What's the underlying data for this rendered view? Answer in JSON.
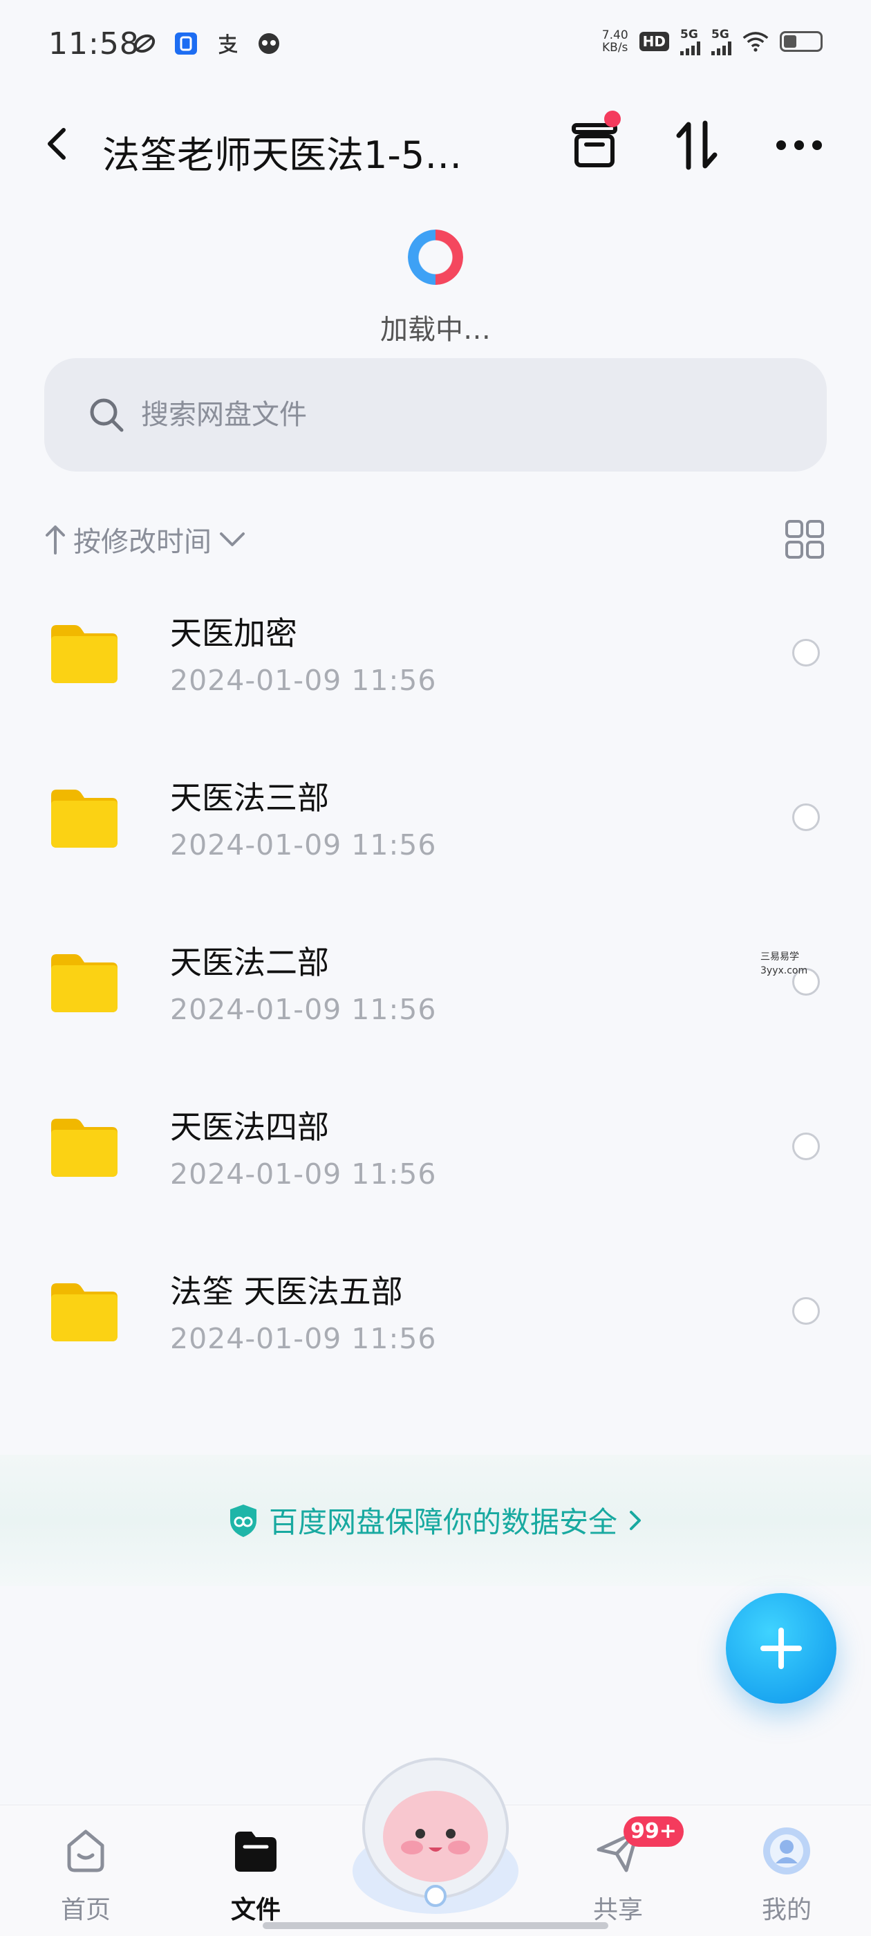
{
  "status_bar": {
    "time": "11:58",
    "net_speed_value": "7.40",
    "net_speed_unit": "KB/s",
    "hd": "HD",
    "sim1": "5G",
    "sim2": "5G",
    "app_icons": [
      "loop-icon",
      "baidu-app-icon",
      "alipay-icon",
      "mascot-face-icon"
    ]
  },
  "header": {
    "title": "法筌老师天医法1-5…"
  },
  "loading": {
    "text": "加载中…"
  },
  "search": {
    "placeholder": "搜索网盘文件"
  },
  "sort": {
    "label": "按修改时间"
  },
  "files": [
    {
      "name": "天医加密",
      "date": "2024-01-09  11:56"
    },
    {
      "name": "天医法三部",
      "date": "2024-01-09  11:56"
    },
    {
      "name": "天医法二部",
      "date": "2024-01-09  11:56"
    },
    {
      "name": "天医法四部",
      "date": "2024-01-09  11:56"
    },
    {
      "name": "法筌 天医法五部",
      "date": "2024-01-09  11:56"
    }
  ],
  "watermark": {
    "line1": "三易易学",
    "line2": "3yyx.com"
  },
  "safety_banner": {
    "text": "百度网盘保障你的数据安全"
  },
  "nav": {
    "items": [
      {
        "label": "首页"
      },
      {
        "label": "文件"
      },
      {
        "label": "共享",
        "badge": "99+"
      },
      {
        "label": "我的"
      }
    ]
  },
  "colors": {
    "accent_blue": "#1ba7f1",
    "badge_red": "#f43b5d",
    "safety_teal": "#18a9a0",
    "folder_yellow": "#f7c600"
  }
}
